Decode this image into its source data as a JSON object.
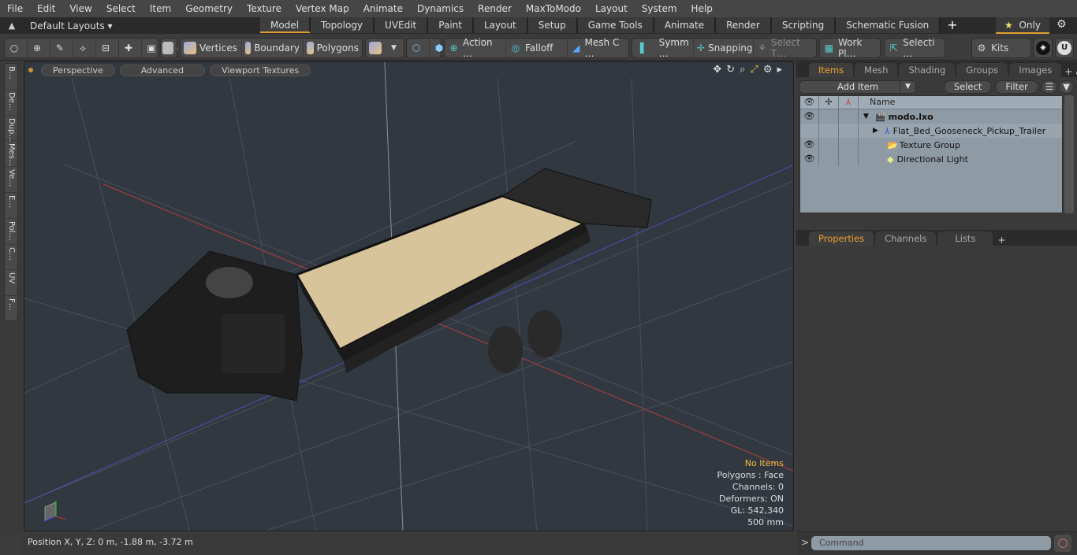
{
  "menu": [
    "File",
    "Edit",
    "View",
    "Select",
    "Item",
    "Geometry",
    "Texture",
    "Vertex Map",
    "Animate",
    "Dynamics",
    "Render",
    "MaxToModo",
    "Layout",
    "System",
    "Help"
  ],
  "layouts": {
    "label": "Default Layouts ▾",
    "tabs": [
      "Model",
      "Topology",
      "UVEdit",
      "Paint",
      "Layout",
      "Setup",
      "Game Tools",
      "Animate",
      "Render",
      "Scripting",
      "Schematic Fusion"
    ],
    "active": "Model",
    "only": "Only"
  },
  "toolbar": {
    "vertices": "Vertices",
    "boundary": "Boundary",
    "polygons": "Polygons",
    "action": "Action …",
    "falloff": "Falloff",
    "meshc": "Mesh C …",
    "symm": "Symm …",
    "snapping": "Snapping",
    "selectt": "Select T…",
    "workpl": "Work Pl…",
    "selecti": "Selecti …",
    "kits": "Kits"
  },
  "lefttabs": [
    "B…",
    "De…",
    "Dup…",
    "Mes…",
    "Ve…",
    "E…",
    "Pol…",
    "C…",
    "UV",
    "F…"
  ],
  "viewport": {
    "perspective": "Perspective",
    "advanced": "Advanced",
    "textures": "Viewport Textures",
    "stats": {
      "items": "No Items",
      "polygons": "Polygons : Face",
      "channels": "Channels: 0",
      "deformers": "Deformers: ON",
      "gl": "GL: 542,340",
      "scale": "500 mm"
    }
  },
  "status": {
    "position": "Position X, Y, Z:   0 m, -1.88 m, -3.72 m"
  },
  "rightpanel": {
    "tabs": [
      "Items",
      "Mesh …",
      "Shading",
      "Groups",
      "Images"
    ],
    "add_item": "Add Item",
    "select": "Select",
    "filter": "Filter",
    "name_header": "Name",
    "tree": [
      {
        "label": "modo.lxo",
        "eye": true,
        "bold": true,
        "icon": "scene-icon"
      },
      {
        "label": "Flat_Bed_Gooseneck_Pickup_Trailer",
        "eye": false,
        "icon": "mesh-icon"
      },
      {
        "label": "Texture Group",
        "eye": true,
        "icon": "folder-icon"
      },
      {
        "label": "Directional Light",
        "eye": true,
        "icon": "light-icon"
      }
    ],
    "prop_tabs": [
      "Properties",
      "Channels",
      "Lists"
    ],
    "command_placeholder": "Command"
  }
}
